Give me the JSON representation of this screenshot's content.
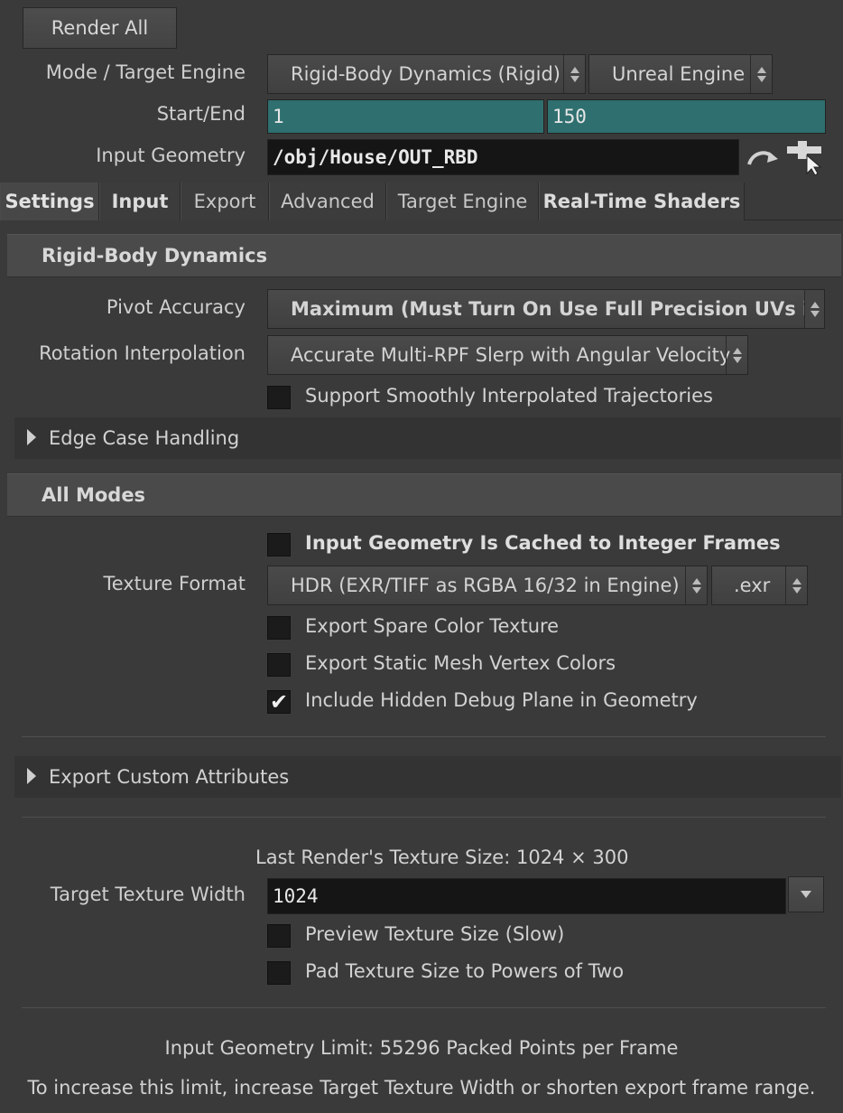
{
  "toolbar": {
    "render_all": "Render All"
  },
  "mode_row": {
    "label": "Mode / Target Engine",
    "mode_value": "Rigid-Body Dynamics (Rigid)",
    "engine_value": "Unreal Engine"
  },
  "range_row": {
    "label": "Start/End",
    "start": "1",
    "end": "150"
  },
  "geometry_row": {
    "label": "Input Geometry",
    "path": "/obj/House/OUT_RBD"
  },
  "tabs": [
    "Settings",
    "Input",
    "Export",
    "Advanced",
    "Target Engine",
    "Real-Time Shaders"
  ],
  "rbd": {
    "title": "Rigid-Body Dynamics",
    "pivot_label": "Pivot Accuracy",
    "pivot_value": "Maximum (Must Turn On Use Full Precision UVs in Unreal)",
    "rotation_label": "Rotation Interpolation",
    "rotation_value": "Accurate Multi-RPF Slerp with Angular Velocity",
    "smooth_label": "Support Smoothly Interpolated Trajectories",
    "smooth_checked": false,
    "edge_case": "Edge Case Handling"
  },
  "all_modes": {
    "title": "All Modes",
    "cached_label": "Input Geometry Is Cached to Integer Frames",
    "cached_checked": false,
    "texture_format_label": "Texture Format",
    "texture_format_value": "HDR (EXR/TIFF as RGBA 16/32 in Engine)",
    "extension_value": ".exr",
    "spare_color_label": "Export Spare Color Texture",
    "spare_color_checked": false,
    "vertex_colors_label": "Export Static Mesh Vertex Colors",
    "vertex_colors_checked": false,
    "debug_plane_label": "Include Hidden Debug Plane in Geometry",
    "debug_plane_checked": true,
    "custom_attributes": "Export Custom Attributes",
    "last_render_size": "Last Render's Texture Size: 1024 × 300",
    "target_width_label": "Target Texture Width",
    "target_width_value": "1024",
    "preview_label": "Preview Texture Size (Slow)",
    "preview_checked": false,
    "pad_label": "Pad Texture Size to Powers of Two",
    "pad_checked": false,
    "limit_text": "Input Geometry Limit: 55296 Packed Points per Frame",
    "hint_text": "To increase this limit, increase Target Texture Width or shorten export frame range."
  },
  "check_glyph": "✔"
}
